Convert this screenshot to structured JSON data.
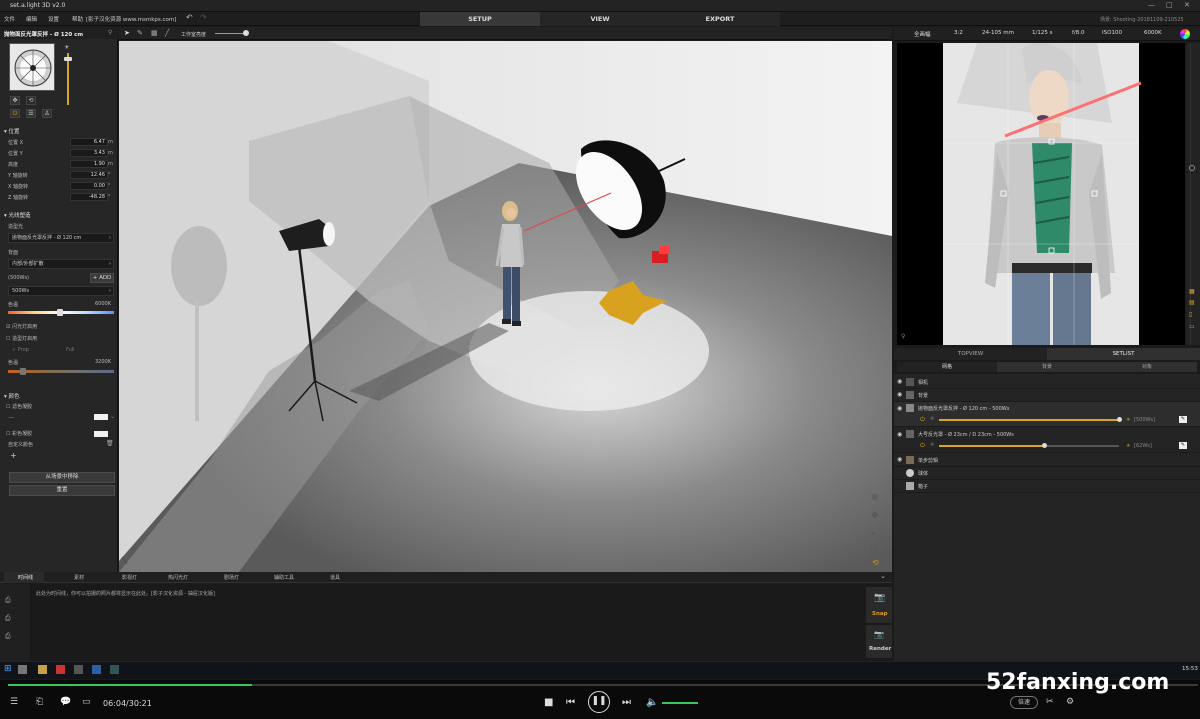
{
  "window": {
    "title": "set.a.light 3D v2.0"
  },
  "menu": [
    "文件",
    "编辑",
    "设置",
    "帮助",
    "[影子汉化资源 www.msmkps.com]"
  ],
  "main_tabs": {
    "setup": "SETUP",
    "view": "VIEW",
    "export": "EXPORT"
  },
  "scene_label": "场景: Shooting-20181109-210525",
  "left_panel": {
    "title": "抛物面反光罩反拌 - Ø 120 cm",
    "section_transform": "位置",
    "props": [
      {
        "label": "位置 X",
        "value": "6.47",
        "unit": "m"
      },
      {
        "label": "位置 Y",
        "value": "3.43",
        "unit": "m"
      },
      {
        "label": "高度",
        "value": "1.90",
        "unit": "m"
      },
      {
        "label": "Y 轴旋转",
        "value": "12.46",
        "unit": "°"
      },
      {
        "label": "X 轴旋转",
        "value": "0.00",
        "unit": "°"
      },
      {
        "label": "Z 轴旋转",
        "value": "-48.28",
        "unit": "°"
      }
    ],
    "section_light": "光线塑造",
    "modifier_label": "造型光",
    "modifier_value": "抛物面反光罩反拌 - Ø 120 cm",
    "diffuser_label": "背面",
    "diffuser_value": "内部/外部扩散",
    "power_label": "(500Ws)",
    "add_label": "ADD",
    "power_value": "500Ws",
    "color_temp_label": "色温",
    "color_temp_value": "6000K",
    "flash_label": "闪光灯启用",
    "modeling_label": "造型灯启用",
    "prop_label": "Prop",
    "full_label": "Full",
    "color_temp2_label": "色温",
    "color_temp2_value": "3200K",
    "section_color": "颜色",
    "gel_label": "滤色凝胶",
    "gel2_label": "彩色凝胶",
    "custom_color_label": "自定义颜色",
    "remove_button": "从场景中移除",
    "reset_button": "重置"
  },
  "viewport_toolbar": {
    "brightness_label": "工作室亮度"
  },
  "camera_bar": {
    "mode": "全画幅",
    "ratio": "3:2",
    "lens": "24-105 mm",
    "shutter": "1/125 s",
    "aperture": "f/8.0",
    "iso": "ISO100",
    "wb": "6000K"
  },
  "right_tabs": {
    "topview": "TOPVIEW",
    "setlist": "SETLIST"
  },
  "sub_tabs": [
    "网格",
    "背景",
    "对象"
  ],
  "setlist": {
    "rows": [
      {
        "label": "相机"
      },
      {
        "label": "背景"
      },
      {
        "label": "抛物面反光罩反拌 - Ø 120 cm - 500Ws",
        "power": "[500Ws]"
      },
      {
        "label": "大号反光罩 - Ø 23cm / D 23cm - 500Ws",
        "power": "[62Ws]"
      },
      {
        "label": "单步剪辑"
      },
      {
        "label": "球体"
      },
      {
        "label": "箱子"
      }
    ]
  },
  "bottom_tabs": [
    "时间线",
    "素材",
    "影视灯",
    "热闪光灯",
    "剧场灯",
    "辅助工具",
    "道具"
  ],
  "timeline_text": "此处为时间线，你可以拍摄的照片都将显示在此处。[影子汉化资源 - 抽屉汉化版]",
  "snap_label": "Snap",
  "render_label": "Render",
  "taskbar": {
    "clock": "15:53"
  },
  "player": {
    "time": "06:04/30:21",
    "progress": 0.2,
    "quality": "倍速"
  },
  "watermark": "52fanxing.com"
}
